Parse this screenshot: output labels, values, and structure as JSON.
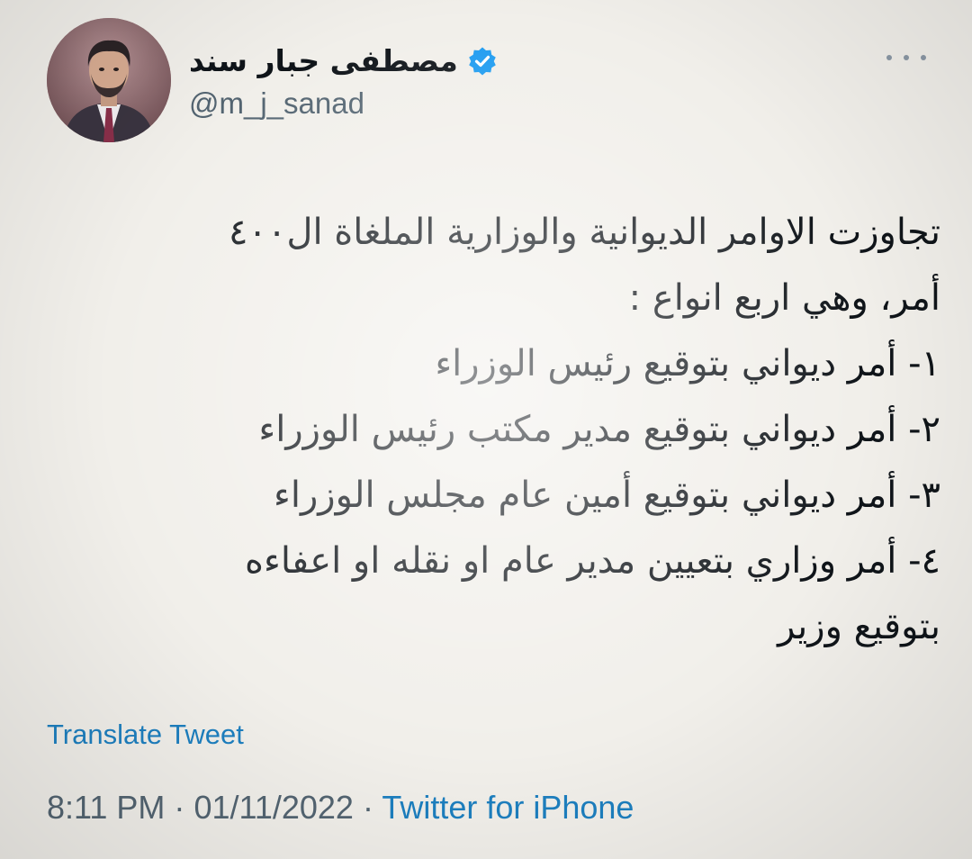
{
  "author": {
    "display_name": "مصطفى جبار سند",
    "handle": "@m_j_sanad",
    "verified": true,
    "avatar_icon": "profile-photo"
  },
  "tweet": {
    "lines": [
      "تجاوزت الاوامر الديوانية والوزارية الملغاة ال٤٠٠",
      "أمر، وهي اربع انواع :",
      "١- أمر ديواني بتوقيع رئيس الوزراء",
      "٢- أمر ديواني بتوقيع مدير مكتب رئيس الوزراء",
      "٣- أمر ديواني بتوقيع أمين عام مجلس الوزراء",
      "٤- أمر وزاري بتعيين مدير عام او نقله او اعفاءه",
      "بتوقيع وزير"
    ]
  },
  "actions": {
    "translate_label": "Translate Tweet",
    "more_icon": "more-dots-icon"
  },
  "meta": {
    "time": "8:11 PM",
    "separator": "·",
    "date": "01/11/2022",
    "source": "Twitter for iPhone"
  },
  "colors": {
    "background": "#f1efea",
    "text": "#0f1419",
    "muted": "#536471",
    "link": "#1d7fbf",
    "verified": "#1d9bf0"
  }
}
